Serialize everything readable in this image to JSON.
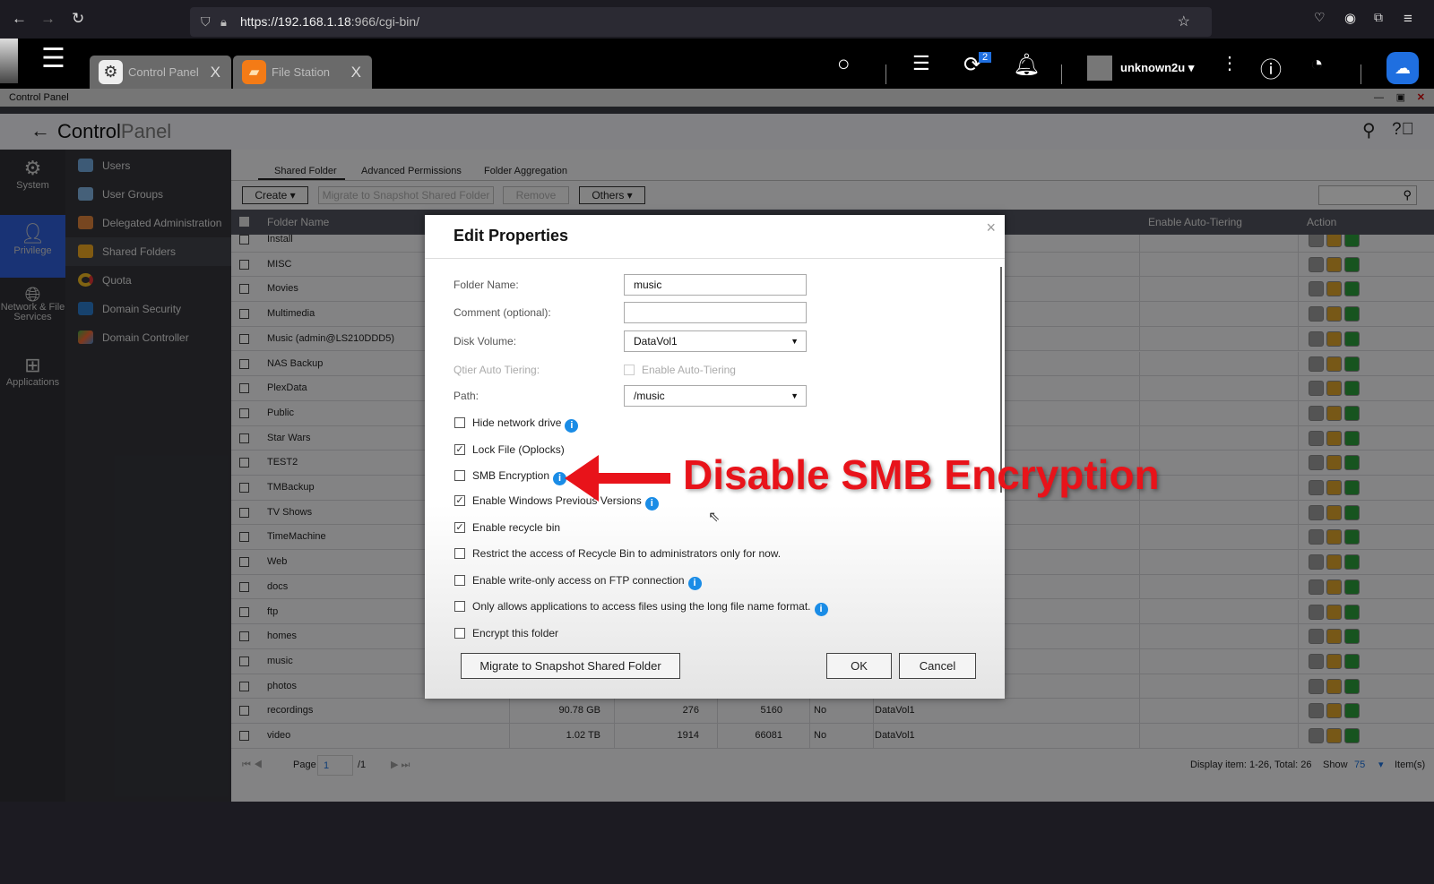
{
  "browser": {
    "url_host": "https://192.168.1.18",
    "url_rest": ":966/cgi-bin/"
  },
  "qts": {
    "tabs": [
      {
        "label": "Control Panel",
        "close": "X",
        "icon": "gear-icon"
      },
      {
        "label": "File Station",
        "close": "X",
        "icon": "folder-icon"
      }
    ],
    "badge_count": "2",
    "username": "unknown2u",
    "dropdown": "▾"
  },
  "window": {
    "title": "Control Panel"
  },
  "header": {
    "title_bold": "Control",
    "title_light": "Panel"
  },
  "left_nav": [
    {
      "label": "System",
      "icon": "gear-icon"
    },
    {
      "label": "Privilege",
      "icon": "user-icon",
      "active": true
    },
    {
      "label": "Network & File Services",
      "icon": "globe-icon"
    },
    {
      "label": "Applications",
      "icon": "grid-icon"
    }
  ],
  "sub_nav": [
    {
      "label": "Users"
    },
    {
      "label": "User Groups"
    },
    {
      "label": "Delegated Administration"
    },
    {
      "label": "Shared Folders",
      "active": true
    },
    {
      "label": "Quota"
    },
    {
      "label": "Domain Security"
    },
    {
      "label": "Domain Controller"
    }
  ],
  "tabs": [
    {
      "label": "Shared Folder",
      "active": true
    },
    {
      "label": "Advanced Permissions"
    },
    {
      "label": "Folder Aggregation"
    }
  ],
  "toolbar": {
    "create": "Create ▾",
    "migrate": "Migrate to Snapshot Shared Folder",
    "remove": "Remove",
    "others": "Others ▾"
  },
  "table": {
    "headers": {
      "name": "Folder Name",
      "tiering": "Enable Auto-Tiering",
      "action": "Action"
    },
    "rows": [
      {
        "name": "Install"
      },
      {
        "name": "MISC"
      },
      {
        "name": "Movies"
      },
      {
        "name": "Multimedia"
      },
      {
        "name": "Music (admin@LS210DDD5)"
      },
      {
        "name": "NAS Backup"
      },
      {
        "name": "PlexData"
      },
      {
        "name": "Public"
      },
      {
        "name": "Star Wars"
      },
      {
        "name": "TEST2"
      },
      {
        "name": "TMBackup"
      },
      {
        "name": "TV Shows"
      },
      {
        "name": "TimeMachine"
      },
      {
        "name": "Web"
      },
      {
        "name": "docs"
      },
      {
        "name": "ftp"
      },
      {
        "name": "homes"
      },
      {
        "name": "music"
      },
      {
        "name": "photos"
      },
      {
        "name": "recordings",
        "size": "90.78 GB",
        "folders": "276",
        "files": "5160",
        "hidden": "No",
        "volume": "DataVol1"
      },
      {
        "name": "video",
        "size": "1.02 TB",
        "folders": "1914",
        "files": "66081",
        "hidden": "No",
        "volume": "DataVol1"
      }
    ]
  },
  "pagination": {
    "page_label": "Page",
    "page": "1",
    "total_pages": "/1",
    "display": "Display item: 1-26, Total: 26",
    "show": "Show",
    "per_page": "75",
    "items": "Item(s)"
  },
  "dialog": {
    "title": "Edit Properties",
    "folder_name_label": "Folder Name:",
    "folder_name": "music",
    "comment_label": "Comment (optional):",
    "comment": "",
    "volume_label": "Disk Volume:",
    "volume": "DataVol1",
    "qtier_label": "Qtier Auto Tiering:",
    "qtier_option": "Enable Auto-Tiering",
    "path_label": "Path:",
    "path": "/music",
    "options": [
      {
        "label": "Hide network drive",
        "checked": false,
        "info": true
      },
      {
        "label": "Lock File (Oplocks)",
        "checked": true,
        "info": false
      },
      {
        "label": "SMB Encryption",
        "checked": false,
        "info": true
      },
      {
        "label": "Enable Windows Previous Versions",
        "checked": true,
        "info": true
      },
      {
        "label": "Enable recycle bin",
        "checked": true,
        "info": false
      },
      {
        "label": "Restrict the access of Recycle Bin to administrators only for now.",
        "checked": false,
        "info": false
      },
      {
        "label": "Enable write-only access on FTP connection",
        "checked": false,
        "info": true
      },
      {
        "label": "Only allows applications to access files using the long file name format.",
        "checked": false,
        "info": true
      },
      {
        "label": "Encrypt this folder",
        "checked": false,
        "info": false
      }
    ],
    "migrate_button": "Migrate to Snapshot Shared Folder",
    "ok": "OK",
    "cancel": "Cancel"
  },
  "annotation": {
    "text": "Disable SMB Encryption",
    "color": "#e8131a"
  }
}
